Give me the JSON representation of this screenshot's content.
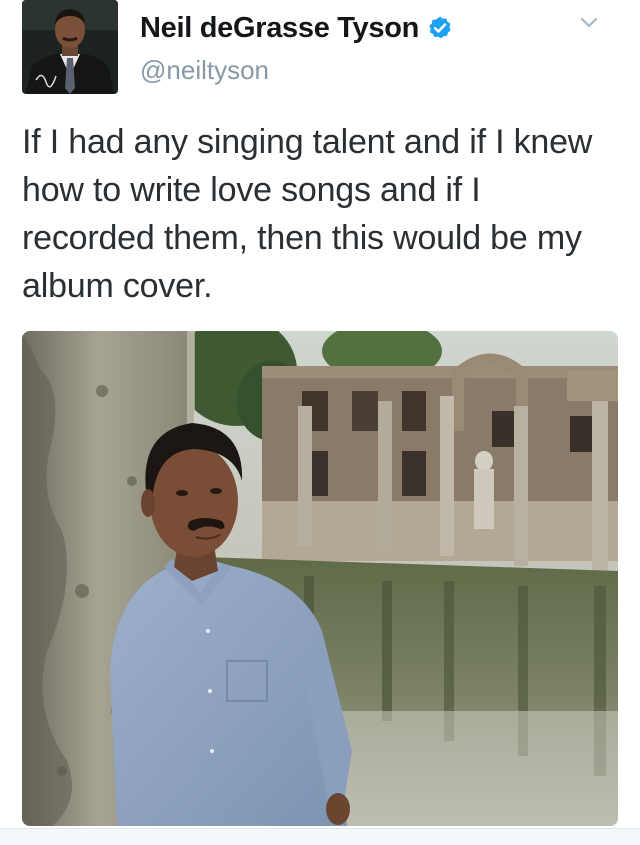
{
  "tweet": {
    "display_name": "Neil deGrasse Tyson",
    "handle": "@neiltyson",
    "verified": true,
    "text": "If I had any singing talent and if I knew\nhow to write love songs and if I\nrecorded them, then this would be my\nalbum cover.",
    "icons": {
      "verified": "verified-badge-icon",
      "menu": "chevron-down-icon"
    },
    "colors": {
      "verified_blue": "#1da1f2",
      "handle_gray": "#8899a6",
      "text": "#292f33"
    }
  }
}
